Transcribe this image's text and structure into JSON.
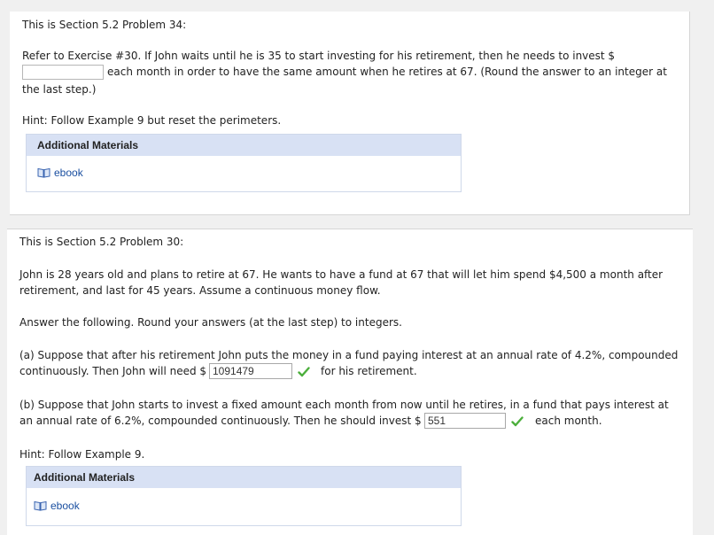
{
  "problem34": {
    "section_line": "This is Section 5.2 Problem 34:",
    "question_line1": "Refer to Exercise #30. If John waits until he is 35 to start investing for his retirement, then he needs to invest $",
    "question_line2": "each month in order to have the same amount when he retires at 67. (Round the answer to an integer at",
    "question_line3": "the last step.)",
    "answer_value": "",
    "hint": "Hint: Follow Example 9 but reset the perimeters.",
    "additional_materials_title": "Additional Materials",
    "ebook_label": "ebook"
  },
  "problem30": {
    "section_line": "This is Section 5.2 Problem 30:",
    "intro_line1": "John is 28 years old and plans to retire at 67. He wants to have a fund at 67 that will let him spend $4,500 a month after",
    "intro_line2": "retirement, and last for 45 years. Assume a continuous money flow.",
    "instructions": "Answer the following. Round your answers (at the last step) to integers.",
    "part_a_line1": "(a) Suppose that after his retirement John puts the money in a fund paying interest at an annual rate of 4.2%, compounded",
    "part_a_prefix": "continuously. Then John will need $",
    "part_a_value": "1091479",
    "part_a_suffix": "for his retirement.",
    "part_b_line1": "(b) Suppose that John starts to invest a fixed amount each month from now until he retires, in a fund that pays interest at",
    "part_b_prefix": "an annual rate of 6.2%, compounded continuously. Then he should invest $",
    "part_b_value": "551",
    "part_b_suffix": "each month.",
    "hint": "Hint: Follow Example 9.",
    "additional_materials_title": "Additional Materials",
    "ebook_label": "ebook"
  },
  "colors": {
    "correct_check": "#4caf3c",
    "link": "#1a4fa0",
    "materials_header": "#d8e1f4"
  },
  "icons": {
    "correct": "checkmark-icon",
    "ebook": "book-icon"
  }
}
